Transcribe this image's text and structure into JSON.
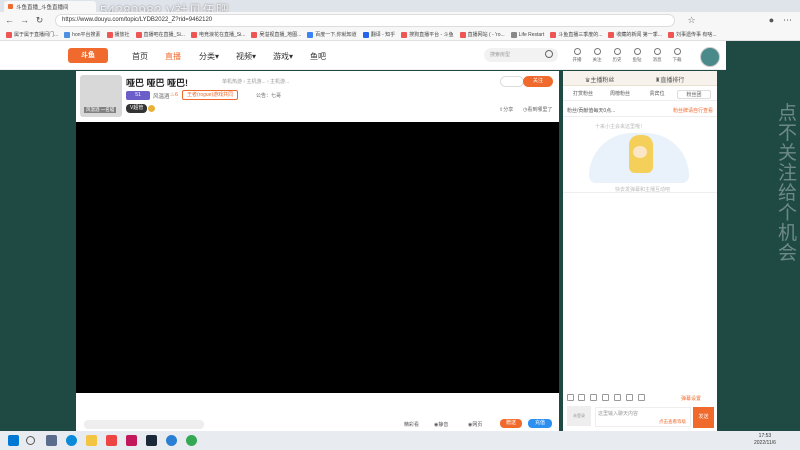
{
  "browser": {
    "tab_title": "斗鱼直播_斗鱼直播间",
    "overlay_text": "54280982 V社见伍肥",
    "url": "https://www.douyu.com/topic/LYDB2022_Z?rid=9462120",
    "bookmarks": [
      "属于属于直播间门...",
      "hon平台搜素",
      "播放社",
      "直播吧在直播_Si...",
      "电竞浪花在直播_Si...",
      "吴溢视直播_地图...",
      "百度一下,你就知道",
      "翻译 - 知乎",
      "搜狗直播平台 - 斗鱼",
      "直播网站 ( - 'ro...",
      "Life Restart",
      "斗鱼直播三季度的...",
      "收藏的新闻 第一季...",
      "刘事遗传事 有啥..."
    ]
  },
  "site": {
    "logo": "斗鱼",
    "nav": [
      "首页",
      "直播",
      "分类",
      "视频",
      "游戏",
      "鱼吧"
    ],
    "search_placeholder": "搜索房型",
    "header_icons": [
      "开播",
      "关注",
      "历史",
      "鱼钻",
      "消息",
      "下载"
    ]
  },
  "room": {
    "title": "哑巴 哑巴 哑巴!",
    "category": "单机热游 › 主机游... › 主机游...",
    "level": "51",
    "anchor": "风温酒",
    "heat": "6",
    "tag": "王者(rogue)游戏共同",
    "notice": "公告：七哥",
    "badge": "V超管",
    "avatar_caption": "风温酒 一名喵",
    "follow": "关注",
    "share": "分享",
    "history": "看到哪里了",
    "bottom": {
      "sort": "精彩看",
      "mute": "静音",
      "fullscreen": "网页",
      "gift": "赠送",
      "recharge": "充值"
    }
  },
  "chat": {
    "top_tabs": [
      "主播粉丝",
      "直播排行"
    ],
    "tabs": [
      "打赏粉丝",
      "周榜粉丝",
      "贵宾位",
      "粉丝团"
    ],
    "rule": "粉丝/贡献值每天0点...",
    "rule_link": "粉丝牌请自行查看",
    "hint": "十来小主会来这里哦！",
    "empty": "快去发弹幕和主播互动吧",
    "toolbar_link": "弹幕设置",
    "input_placeholder": "这里输入聊天内容",
    "level_hint": "点击查看等级",
    "avatar_label": "未登录",
    "send": "发送"
  },
  "side_text": "点不关注 给个机会",
  "taskbar": {
    "time": "17:53",
    "date": "2022/11/6"
  }
}
